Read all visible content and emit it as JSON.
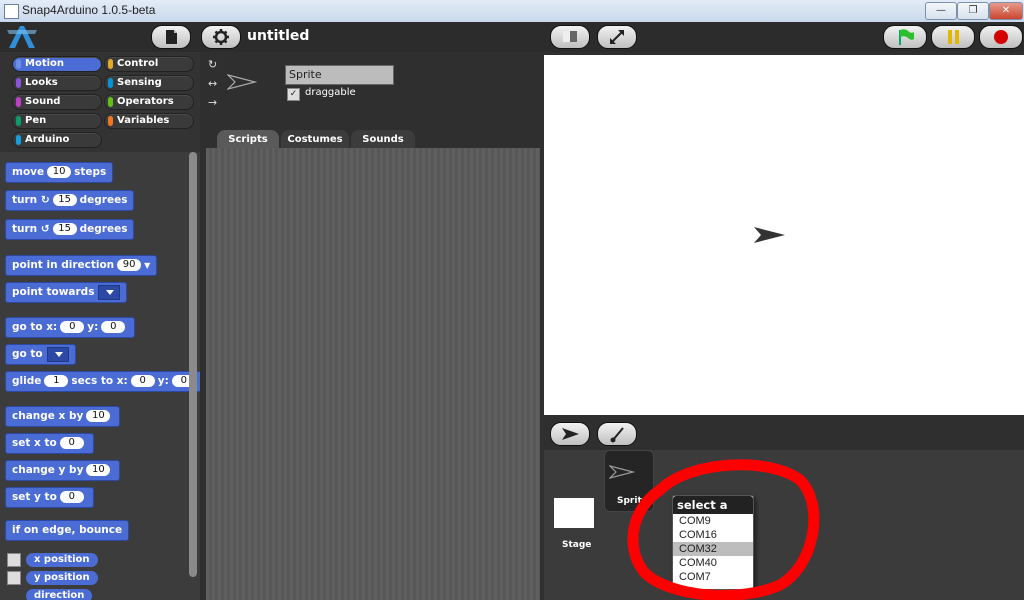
{
  "window": {
    "title": "Snap4Arduino 1.0.5-beta"
  },
  "project": {
    "name": "untitled"
  },
  "categories": [
    {
      "label": "Motion",
      "color": "#4a6cd4",
      "selected": true
    },
    {
      "label": "Looks",
      "color": "#8a55d7"
    },
    {
      "label": "Sound",
      "color": "#bb42c3"
    },
    {
      "label": "Pen",
      "color": "#0e9a6c"
    },
    {
      "label": "Arduino",
      "color": "#1a9ed9"
    },
    {
      "label": "Control",
      "color": "#e6a822"
    },
    {
      "label": "Sensing",
      "color": "#0494dc"
    },
    {
      "label": "Operators",
      "color": "#62c213"
    },
    {
      "label": "Variables",
      "color": "#f3761d"
    }
  ],
  "blocks": {
    "move": {
      "pre": "move",
      "val": "10",
      "post": "steps"
    },
    "turn_cw": {
      "pre": "turn",
      "val": "15",
      "post": "degrees"
    },
    "turn_ccw": {
      "pre": "turn",
      "val": "15",
      "post": "degrees"
    },
    "point_dir": {
      "pre": "point in direction",
      "val": "90"
    },
    "point_towards": {
      "pre": "point towards"
    },
    "goto_xy": {
      "pre": "go to x:",
      "x": "0",
      "mid": "y:",
      "y": "0"
    },
    "goto": {
      "pre": "go to"
    },
    "glide": {
      "pre": "glide",
      "secs": "1",
      "mid": "secs to x:",
      "x": "0",
      "mid2": "y:",
      "y": "0"
    },
    "change_x": {
      "pre": "change x by",
      "val": "10"
    },
    "set_x": {
      "pre": "set x to",
      "val": "0"
    },
    "change_y": {
      "pre": "change y by",
      "val": "10"
    },
    "set_y": {
      "pre": "set y to",
      "val": "0"
    },
    "bounce": {
      "pre": "if on edge, bounce"
    },
    "xpos": "x position",
    "ypos": "y position",
    "direction": "direction"
  },
  "sprite": {
    "name": "Sprite",
    "draggable_label": "draggable",
    "draggable": true
  },
  "tabs": [
    "Scripts",
    "Costumes",
    "Sounds"
  ],
  "corral": {
    "stage_label": "Stage",
    "sprite_label": "Sprite"
  },
  "port_menu": {
    "title": "select a port",
    "items": [
      "COM9",
      "COM16",
      "COM32",
      "COM40",
      "COM7"
    ],
    "highlighted_index": 2
  }
}
